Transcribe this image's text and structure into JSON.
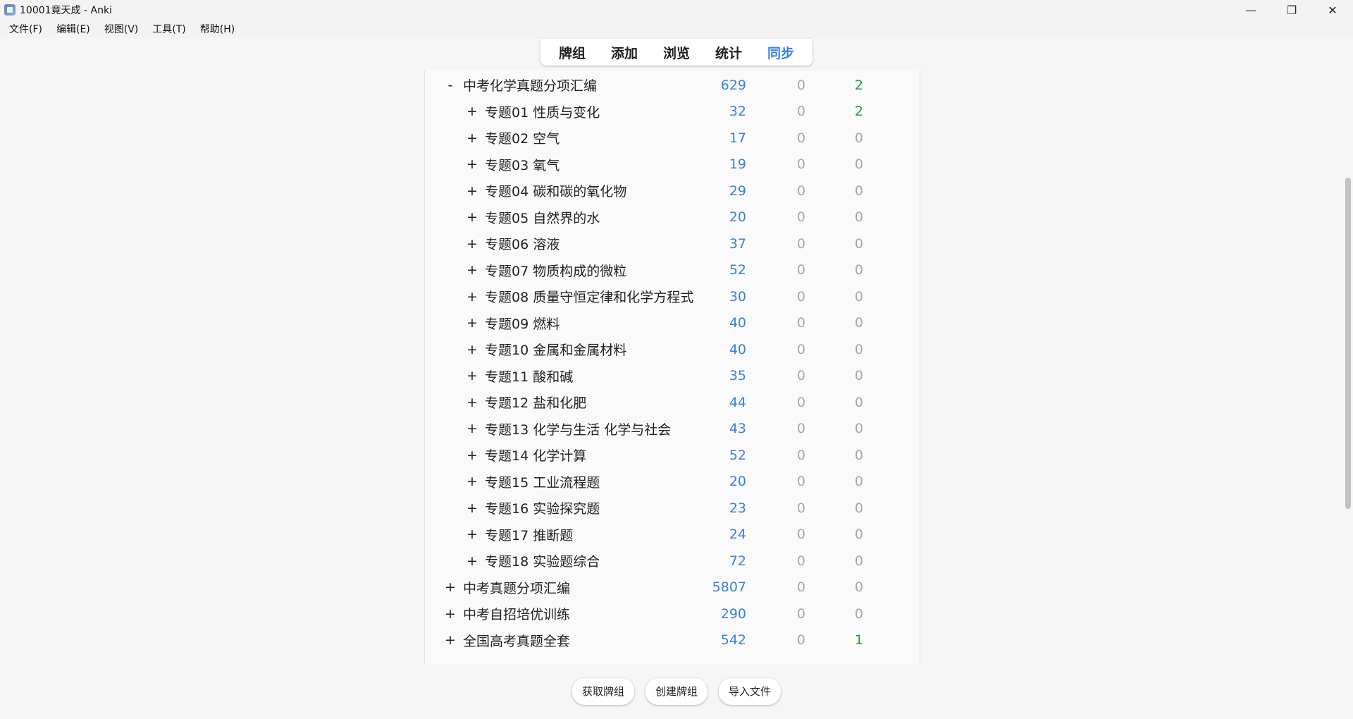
{
  "window": {
    "title": "10001竟天成 - Anki",
    "minimize": "—",
    "maximize": "❐",
    "close": "✕"
  },
  "menu": [
    {
      "label": "文件(F)"
    },
    {
      "label": "编辑(E)"
    },
    {
      "label": "视图(V)"
    },
    {
      "label": "工具(T)"
    },
    {
      "label": "帮助(H)"
    }
  ],
  "nav": [
    {
      "label": "牌组",
      "active": false
    },
    {
      "label": "添加",
      "active": false
    },
    {
      "label": "浏览",
      "active": false
    },
    {
      "label": "统计",
      "active": false
    },
    {
      "label": "同步",
      "active": true
    }
  ],
  "colors": {
    "new": "#3b82d6",
    "learn": "#a8a8a8",
    "due_nonzero": "#1f9d3f",
    "active_nav": "#3b82d6"
  },
  "decks": [
    {
      "toggle": "-",
      "name": "中考化学真题分项汇编",
      "level": 0,
      "new": "629",
      "learn": "0",
      "due": "2"
    },
    {
      "toggle": "+",
      "name": "专题01 性质与变化",
      "level": 1,
      "new": "32",
      "learn": "0",
      "due": "2"
    },
    {
      "toggle": "+",
      "name": "专题02 空气",
      "level": 1,
      "new": "17",
      "learn": "0",
      "due": "0"
    },
    {
      "toggle": "+",
      "name": "专题03 氧气",
      "level": 1,
      "new": "19",
      "learn": "0",
      "due": "0"
    },
    {
      "toggle": "+",
      "name": "专题04 碳和碳的氧化物",
      "level": 1,
      "new": "29",
      "learn": "0",
      "due": "0"
    },
    {
      "toggle": "+",
      "name": "专题05 自然界的水",
      "level": 1,
      "new": "20",
      "learn": "0",
      "due": "0"
    },
    {
      "toggle": "+",
      "name": "专题06 溶液",
      "level": 1,
      "new": "37",
      "learn": "0",
      "due": "0"
    },
    {
      "toggle": "+",
      "name": "专题07 物质构成的微粒",
      "level": 1,
      "new": "52",
      "learn": "0",
      "due": "0"
    },
    {
      "toggle": "+",
      "name": "专题08 质量守恒定律和化学方程式",
      "level": 1,
      "new": "30",
      "learn": "0",
      "due": "0"
    },
    {
      "toggle": "+",
      "name": "专题09 燃料",
      "level": 1,
      "new": "40",
      "learn": "0",
      "due": "0"
    },
    {
      "toggle": "+",
      "name": "专题10 金属和金属材料",
      "level": 1,
      "new": "40",
      "learn": "0",
      "due": "0"
    },
    {
      "toggle": "+",
      "name": "专题11 酸和碱",
      "level": 1,
      "new": "35",
      "learn": "0",
      "due": "0"
    },
    {
      "toggle": "+",
      "name": "专题12 盐和化肥",
      "level": 1,
      "new": "44",
      "learn": "0",
      "due": "0"
    },
    {
      "toggle": "+",
      "name": "专题13 化学与生活 化学与社会",
      "level": 1,
      "new": "43",
      "learn": "0",
      "due": "0"
    },
    {
      "toggle": "+",
      "name": "专题14 化学计算",
      "level": 1,
      "new": "52",
      "learn": "0",
      "due": "0"
    },
    {
      "toggle": "+",
      "name": "专题15 工业流程题",
      "level": 1,
      "new": "20",
      "learn": "0",
      "due": "0"
    },
    {
      "toggle": "+",
      "name": "专题16 实验探究题",
      "level": 1,
      "new": "23",
      "learn": "0",
      "due": "0"
    },
    {
      "toggle": "+",
      "name": "专题17 推断题",
      "level": 1,
      "new": "24",
      "learn": "0",
      "due": "0"
    },
    {
      "toggle": "+",
      "name": "专题18 实验题综合",
      "level": 1,
      "new": "72",
      "learn": "0",
      "due": "0"
    },
    {
      "toggle": "+",
      "name": "中考真题分项汇编",
      "level": 0,
      "new": "5807",
      "learn": "0",
      "due": "0"
    },
    {
      "toggle": "+",
      "name": "中考自招培优训练",
      "level": 0,
      "new": "290",
      "learn": "0",
      "due": "0"
    },
    {
      "toggle": "+",
      "name": "全国高考真题全套",
      "level": 0,
      "new": "542",
      "learn": "0",
      "due": "1"
    }
  ],
  "bottom_buttons": [
    {
      "label": "获取牌组"
    },
    {
      "label": "创建牌组"
    },
    {
      "label": "导入文件"
    }
  ]
}
